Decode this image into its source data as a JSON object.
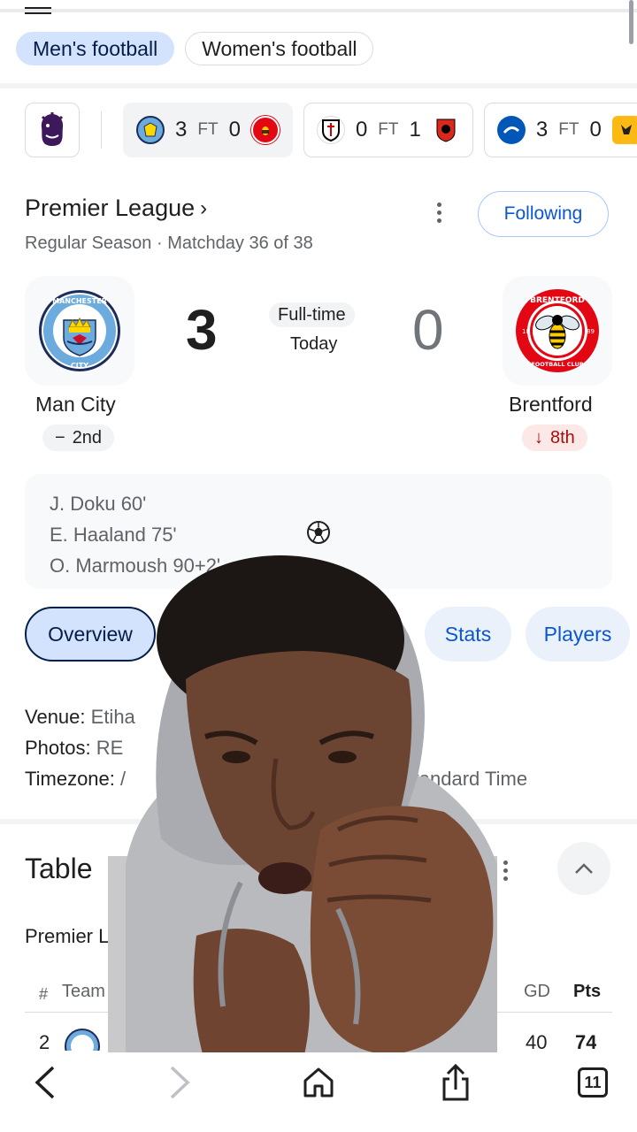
{
  "chips": [
    {
      "label": "Men's football",
      "active": true
    },
    {
      "label": "Women's football",
      "active": false
    }
  ],
  "strip": {
    "matches": [
      {
        "home_score": "3",
        "status": "FT",
        "away_score": "0",
        "home_crest": "man-city-crest",
        "away_crest": "brentford-crest"
      },
      {
        "home_score": "0",
        "status": "FT",
        "away_score": "1",
        "home_crest": "fulham-crest",
        "away_crest": "bournemouth-crest"
      },
      {
        "home_score": "3",
        "status": "FT",
        "away_score": "0",
        "home_crest": "brighton-crest",
        "away_crest": "wolves-crest"
      }
    ]
  },
  "league": {
    "title": "Premier League",
    "chevron": "›",
    "season": "Regular Season · Matchday 36 of 38",
    "following_label": "Following"
  },
  "match": {
    "home": {
      "name": "Man City",
      "score": "3",
      "rank": "2nd",
      "rank_symbol": "−",
      "crest_top": "MANCHESTER",
      "crest_bottom": "CITY"
    },
    "away": {
      "name": "Brentford",
      "score": "0",
      "rank": "8th",
      "rank_symbol": "↓",
      "crest_top": "BRENTFORD",
      "crest_bottom": "FOOTBALL CLUB",
      "crest_left": "18",
      "crest_right": "89"
    },
    "status": "Full-time",
    "day": "Today",
    "scorers": [
      "J. Doku 60'",
      "E. Haaland 75'",
      "O. Marmoush 90+2'"
    ]
  },
  "tabs": [
    {
      "label": "Overview",
      "active": true
    },
    {
      "label": "Stats",
      "active": false
    },
    {
      "label": "Players",
      "active": false
    }
  ],
  "info": {
    "venue_label": "Venue:",
    "venue_value": "Etiha",
    "photos_label": "Photos:",
    "photos_value": "RE",
    "timezone_label": "Timezone:",
    "timezone_value": "/",
    "timezone_tail": "Standard Time"
  },
  "table": {
    "title": "Table",
    "league": "Premier L",
    "col_hash": "#",
    "col_team": "Team",
    "col_gd": "GD",
    "col_pts": "Pts",
    "row": {
      "pos": "2",
      "gd": "40",
      "pts": "74"
    }
  },
  "bottom_nav": {
    "tab_count": "11"
  },
  "colors": {
    "accent": "#0b57d0",
    "chip_active": "#d3e3fd",
    "man_city_blue": "#6cabdd",
    "brentford_red": "#e30613"
  }
}
